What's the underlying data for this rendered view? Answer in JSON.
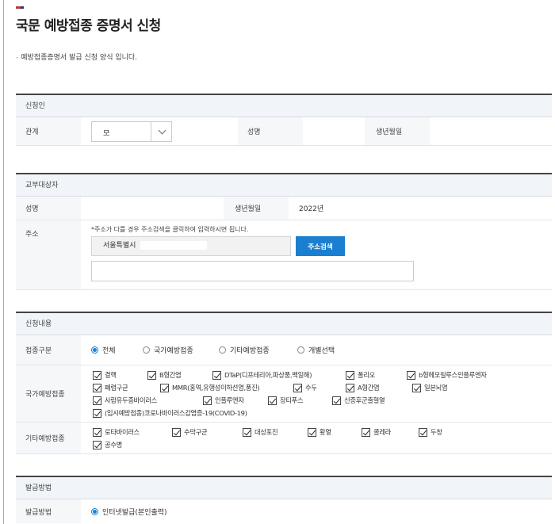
{
  "page": {
    "title": "국문 예방접종 증명서 신청",
    "description": "예방접종증명서 발급 신청 양식 입니다."
  },
  "applicant": {
    "section_title": "신청인",
    "relation_label": "관계",
    "relation_value": "모",
    "name_label": "성명",
    "birth_label": "생년월일"
  },
  "recipient": {
    "section_title": "교부대상자",
    "name_label": "성명",
    "birth_label": "생년월일",
    "birth_value": "2022년",
    "address_label": "주소",
    "address_note": "*주소가 다를 경우 주소검색을 클릭하여 입력하시면 됩니다.",
    "address_value": "서울특별시",
    "address_button": "주소검색"
  },
  "request": {
    "section_title": "신청내용",
    "type_label": "접종구분",
    "types": [
      {
        "label": "전체",
        "checked": true
      },
      {
        "label": "국가예방접종",
        "checked": false
      },
      {
        "label": "기타예방접종",
        "checked": false
      },
      {
        "label": "개별선택",
        "checked": false
      }
    ],
    "national_label": "국가예방접종",
    "national_items": [
      "결핵",
      "B형간염",
      "DTaP(디프테리아,파상풍,백일해)",
      "폴리오",
      "b형헤모필루스인플루엔자",
      "폐렴구균",
      "MMR(홍역,유행성이하선염,풍진)",
      "수두",
      "A형간염",
      "일본뇌염",
      "사람유두종바이러스",
      "인플루엔자",
      "장티푸스",
      "신증후군출혈열",
      "(임시예방접종)코로나바이러스감염증-19(COVID-19)"
    ],
    "other_label": "기타예방접종",
    "other_items": [
      "로타바이러스",
      "수막구균",
      "대상포진",
      "황열",
      "콜레라",
      "두창",
      "공수병"
    ]
  },
  "issue": {
    "section_title": "발급방법",
    "method_label": "발급방법",
    "method_value": "인터넷발급(본인출력)"
  },
  "colors": {
    "accent": "#1a7fd1",
    "label_bg": "#f6f7f9",
    "section_bg": "#f1f4f8"
  }
}
